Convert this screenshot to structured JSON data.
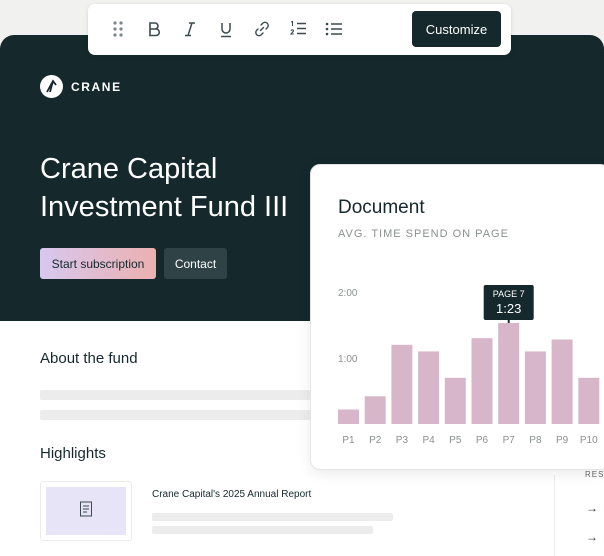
{
  "toolbar": {
    "icons": [
      "drag-handle-icon",
      "bold-icon",
      "italic-icon",
      "underline-icon",
      "link-icon",
      "numbered-list-icon",
      "bulleted-list-icon"
    ],
    "customize_label": "Customize"
  },
  "hero": {
    "brand": "CRANE",
    "title": "Crane Capital Investment Fund III",
    "start_label": "Start subscription",
    "contact_label": "Contact",
    "bg_color": "#15292c"
  },
  "about": {
    "heading": "About the fund"
  },
  "highlights": {
    "heading": "Highlights",
    "report_title": "Crane Capital's 2025 Annual Report",
    "side_label": "RES"
  },
  "document": {
    "title": "Document",
    "subtitle": "AVG. TIME SPEND ON PAGE"
  },
  "chart_data": {
    "type": "bar",
    "categories": [
      "P1",
      "P2",
      "P3",
      "P4",
      "P5",
      "P6",
      "P7",
      "P8",
      "P9",
      "P10"
    ],
    "values": [
      0.22,
      0.42,
      1.2,
      1.1,
      0.7,
      1.3,
      1.53,
      1.1,
      1.28,
      0.7
    ],
    "y_ticks": [
      {
        "value": 1,
        "label": "1:00"
      },
      {
        "value": 2,
        "label": "2:00"
      }
    ],
    "ylim": [
      0,
      2
    ],
    "tooltip": {
      "label": "PAGE 7",
      "value": "1:23",
      "category_index": 6
    },
    "bar_color": "#d8b6c9"
  }
}
